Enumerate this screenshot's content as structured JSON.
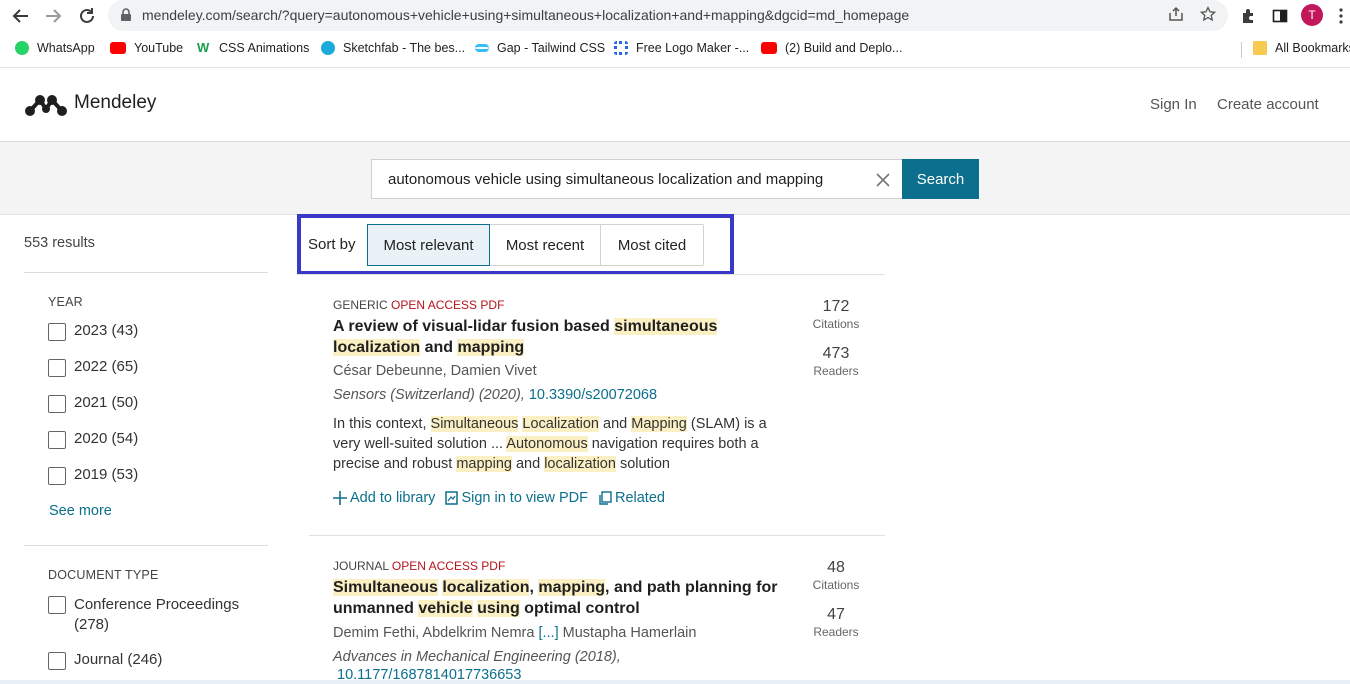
{
  "browser": {
    "url": "mendeley.com/search/?query=autonomous+vehicle+using+simultaneous+localization+and+mapping&dgcid=md_homepage",
    "avatar_letter": "T",
    "bookmarks": [
      {
        "label": "WhatsApp",
        "icon": "whatsapp-icon",
        "color": "#25d366"
      },
      {
        "label": "YouTube",
        "icon": "youtube-icon",
        "color": "#ff0000"
      },
      {
        "label": "CSS Animations",
        "icon": "w-icon",
        "color": "#1a9e4b"
      },
      {
        "label": "Sketchfab - The bes...",
        "icon": "sketchfab-icon",
        "color": "#1caad9"
      },
      {
        "label": "Gap - Tailwind CSS",
        "icon": "tailwind-icon",
        "color": "#38bdf8"
      },
      {
        "label": "Free Logo Maker -...",
        "icon": "logo-maker-icon",
        "color": "#2563eb"
      },
      {
        "label": "(2) Build and Deplo...",
        "icon": "youtube-icon",
        "color": "#ff0000"
      }
    ],
    "all_bookmarks": "All Bookmarks"
  },
  "header": {
    "logo": "Mendeley",
    "sign_in": "Sign In",
    "create_account": "Create account"
  },
  "search": {
    "query": "autonomous vehicle using simultaneous localization and mapping",
    "button": "Search"
  },
  "sidebar": {
    "results_count": "553 results",
    "year_title": "YEAR",
    "years": [
      "2023 (43)",
      "2022 (65)",
      "2021 (50)",
      "2020 (54)",
      "2019 (53)"
    ],
    "see_more": "See more",
    "doctype_title": "DOCUMENT TYPE",
    "doctypes": [
      "Conference Proceedings (278)",
      "Journal (246)"
    ]
  },
  "sort": {
    "label": "Sort by",
    "options": [
      "Most relevant",
      "Most recent",
      "Most cited"
    ],
    "active": "Most relevant"
  },
  "results": [
    {
      "type": "GENERIC",
      "open_access": "OPEN ACCESS",
      "pdf": "PDF",
      "title_parts": [
        {
          "t": "A review of visual-lidar fusion based ",
          "h": false
        },
        {
          "t": "simultaneous localization",
          "h": true
        },
        {
          "t": " and ",
          "h": false
        },
        {
          "t": "mapping",
          "h": true
        }
      ],
      "authors": "César Debeunne, Damien Vivet",
      "authors_more": "",
      "authors_tail": "",
      "source": "Sensors (Switzerland) (2020), ",
      "doi": "10.3390/s20072068",
      "abstract_parts": [
        {
          "t": "In this context, ",
          "h": false
        },
        {
          "t": "Simultaneous",
          "h": true
        },
        {
          "t": " ",
          "h": false
        },
        {
          "t": "Localization",
          "h": true
        },
        {
          "t": " and ",
          "h": false
        },
        {
          "t": "Mapping",
          "h": true
        },
        {
          "t": " (SLAM) is a very well-suited solution ... ",
          "h": false
        },
        {
          "t": "Autonomous",
          "h": true
        },
        {
          "t": " navigation requires both a precise and robust ",
          "h": false
        },
        {
          "t": "mapping",
          "h": true
        },
        {
          "t": " and ",
          "h": false
        },
        {
          "t": "localization",
          "h": true
        },
        {
          "t": " solution",
          "h": false
        }
      ],
      "citations": "172",
      "citations_label": "Citations",
      "readers": "473",
      "readers_label": "Readers",
      "actions": [
        "Add to library",
        "Sign in to view PDF",
        "Related"
      ]
    },
    {
      "type": "JOURNAL",
      "open_access": "OPEN ACCESS",
      "pdf": "PDF",
      "title_parts": [
        {
          "t": "Simultaneous",
          "h": true
        },
        {
          "t": " ",
          "h": false
        },
        {
          "t": "localization",
          "h": true
        },
        {
          "t": ", ",
          "h": false
        },
        {
          "t": "mapping",
          "h": true
        },
        {
          "t": ", and path planning for unmanned ",
          "h": false
        },
        {
          "t": "vehicle",
          "h": true
        },
        {
          "t": " ",
          "h": false
        },
        {
          "t": "using",
          "h": true
        },
        {
          "t": " optimal control",
          "h": false
        }
      ],
      "authors": "Demim Fethi, Abdelkrim Nemra ",
      "authors_more": "[...]",
      "authors_tail": " Mustapha Hamerlain",
      "source": "Advances in Mechanical Engineering (2018),",
      "doi": "10.1177/1687814017736653",
      "citations": "48",
      "citations_label": "Citations",
      "readers": "47",
      "readers_label": "Readers"
    }
  ]
}
